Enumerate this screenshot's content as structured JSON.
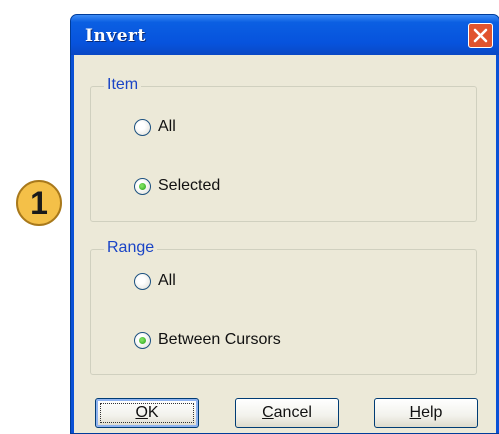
{
  "callout": {
    "number": "1"
  },
  "window": {
    "title": "Invert",
    "close_icon": "close-icon"
  },
  "item_group": {
    "legend": "Item",
    "options": [
      {
        "label": "All",
        "selected": false
      },
      {
        "label": "Selected",
        "selected": true
      }
    ]
  },
  "range_group": {
    "legend": "Range",
    "options": [
      {
        "label": "All",
        "selected": false
      },
      {
        "label": "Between Cursors",
        "selected": true
      }
    ]
  },
  "buttons": {
    "ok": {
      "mnemonic": "O",
      "rest": "K"
    },
    "cancel": {
      "mnemonic": "C",
      "rest": "ancel"
    },
    "help": {
      "mnemonic": "H",
      "rest": "elp"
    }
  },
  "colors": {
    "title_bar": "#0753dd",
    "dialog_face": "#ece9d8",
    "legend_text": "#1a44c6",
    "callout": "#f4c048",
    "bracket": "#e8a020"
  }
}
